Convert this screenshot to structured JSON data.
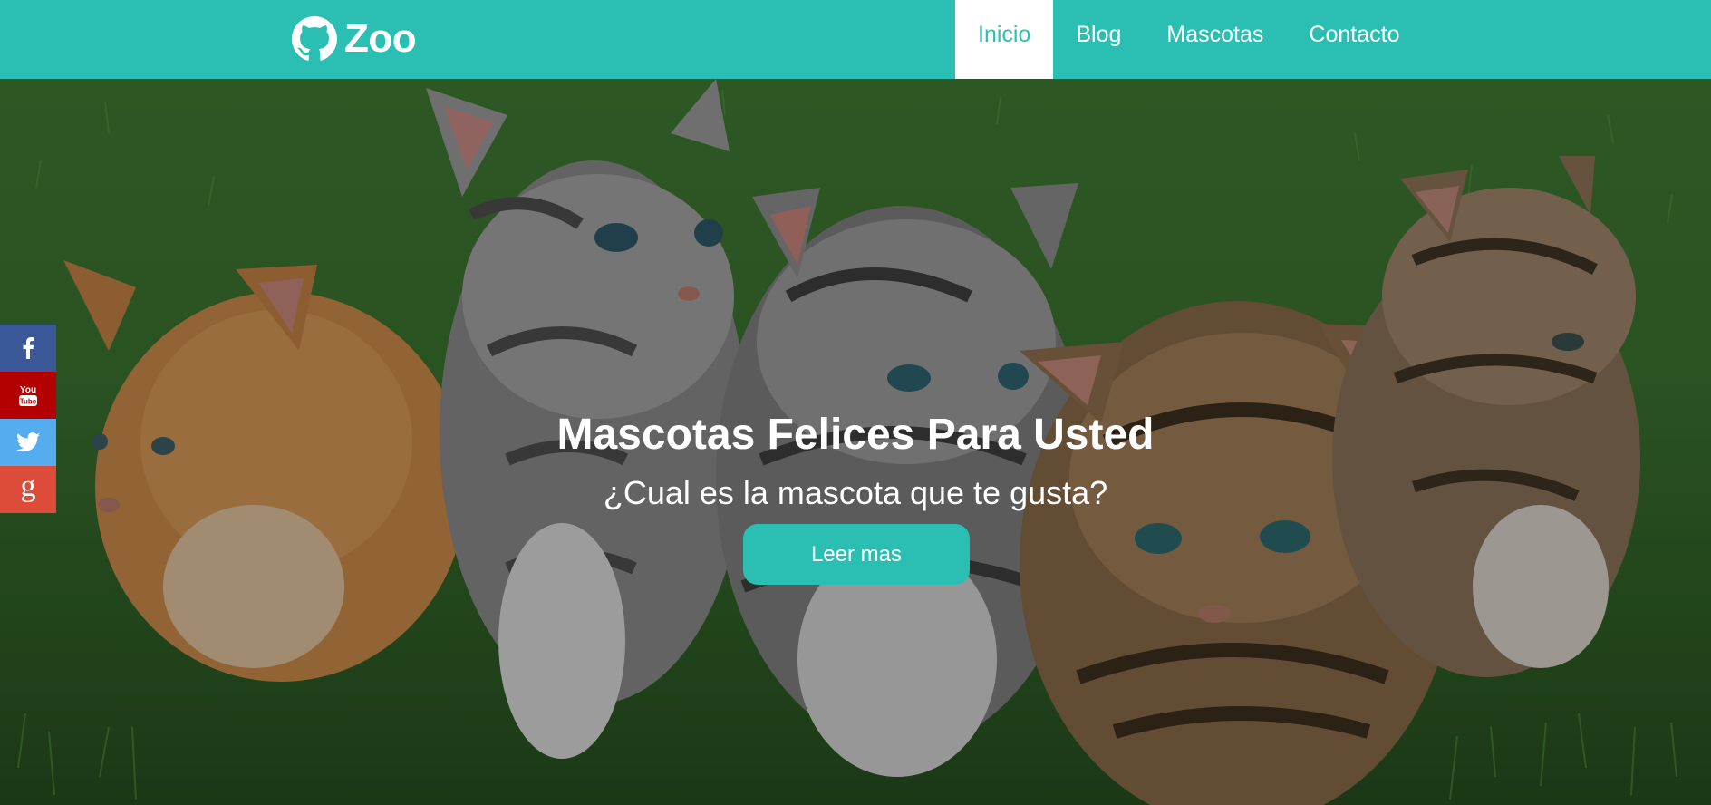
{
  "brand": {
    "name": "Zoo",
    "icon": "github-icon"
  },
  "nav": {
    "items": [
      {
        "label": "Inicio",
        "active": true
      },
      {
        "label": "Blog",
        "active": false
      },
      {
        "label": "Mascotas",
        "active": false
      },
      {
        "label": "Contacto",
        "active": false
      }
    ]
  },
  "hero": {
    "title": "Mascotas Felices Para Usted",
    "subtitle": "¿Cual es la mascota que te gusta?",
    "button_label": "Leer mas"
  },
  "social": [
    {
      "name": "facebook-icon",
      "color": "#3b5998"
    },
    {
      "name": "youtube-icon",
      "color": "#b30000",
      "text": "You Tube"
    },
    {
      "name": "twitter-icon",
      "color": "#55acee"
    },
    {
      "name": "google-plus-icon",
      "color": "#dd4b39",
      "text": "g"
    }
  ],
  "colors": {
    "accent": "#2bbfb4",
    "white": "#ffffff"
  }
}
